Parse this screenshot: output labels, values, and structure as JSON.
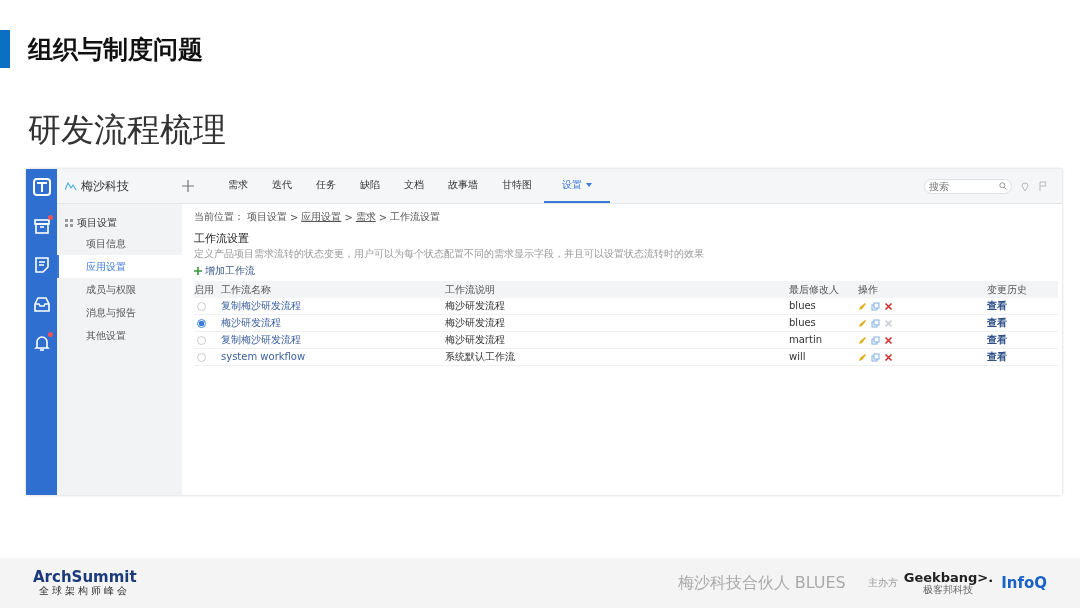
{
  "slide": {
    "title": "组织与制度问题",
    "subtitle": "研发流程梳理"
  },
  "app": {
    "rail_icons": [
      {
        "kind": "logo",
        "badge": false
      },
      {
        "kind": "archive",
        "badge": true
      },
      {
        "kind": "note",
        "badge": false
      },
      {
        "kind": "inbox",
        "badge": false
      },
      {
        "kind": "bell",
        "badge": true
      }
    ],
    "brand": "梅沙科技",
    "tabs": [
      {
        "label": "需求",
        "selected": false
      },
      {
        "label": "迭代",
        "selected": false
      },
      {
        "label": "任务",
        "selected": false
      },
      {
        "label": "缺陷",
        "selected": false
      },
      {
        "label": "文档",
        "selected": false
      },
      {
        "label": "故事墙",
        "selected": false
      },
      {
        "label": "甘特图",
        "selected": false
      },
      {
        "label": "设置",
        "selected": true
      }
    ],
    "search": {
      "placeholder": "搜索"
    },
    "sidebar": {
      "title": "项目设置",
      "items": [
        {
          "label": "项目信息",
          "selected": false
        },
        {
          "label": "应用设置",
          "selected": true
        },
        {
          "label": "成员与权限",
          "selected": false
        },
        {
          "label": "消息与报告",
          "selected": false
        },
        {
          "label": "其他设置",
          "selected": false
        }
      ]
    },
    "breadcrumb": {
      "label": "当前位置：",
      "separator": ">",
      "items": [
        {
          "text": "项目设置",
          "link": false
        },
        {
          "text": "应用设置",
          "link": true
        },
        {
          "text": "需求",
          "link": true
        },
        {
          "text": "工作流设置",
          "link": false
        }
      ]
    },
    "section_title": "工作流设置",
    "description": "定义产品项目需求流转的状态变更，用户可以为每个状态配置不同的需求显示字段，并且可以设置状态流转时的效果",
    "add_button": "增加工作流",
    "table": {
      "columns": [
        "启用",
        "工作流名称",
        "工作流说明",
        "最后修改人",
        "操作",
        "变更历史"
      ],
      "rows": [
        {
          "selected": false,
          "name": "复制梅沙研发流程",
          "description": "梅沙研发流程",
          "modifier": "blues",
          "deletable": true,
          "history": "查看"
        },
        {
          "selected": true,
          "name": "梅沙研发流程",
          "description": "梅沙研发流程",
          "modifier": "blues",
          "deletable": false,
          "history": "查看"
        },
        {
          "selected": false,
          "name": "复制梅沙研发流程",
          "description": "梅沙研发流程",
          "modifier": "martin",
          "deletable": true,
          "history": "查看"
        },
        {
          "selected": false,
          "name": "system workflow",
          "description": "系统默认工作流",
          "modifier": "will",
          "deletable": true,
          "history": "查看"
        }
      ]
    }
  },
  "footer": {
    "event_logo": "ArchSummit",
    "event_tagline": "全球架构师峰会",
    "text": "梅沙科技合伙人 BLUES",
    "host_label": "主办方",
    "host_logo": "Geekbang>.",
    "host_tagline": "极客邦科技",
    "partner_logo": "InfoQ"
  }
}
